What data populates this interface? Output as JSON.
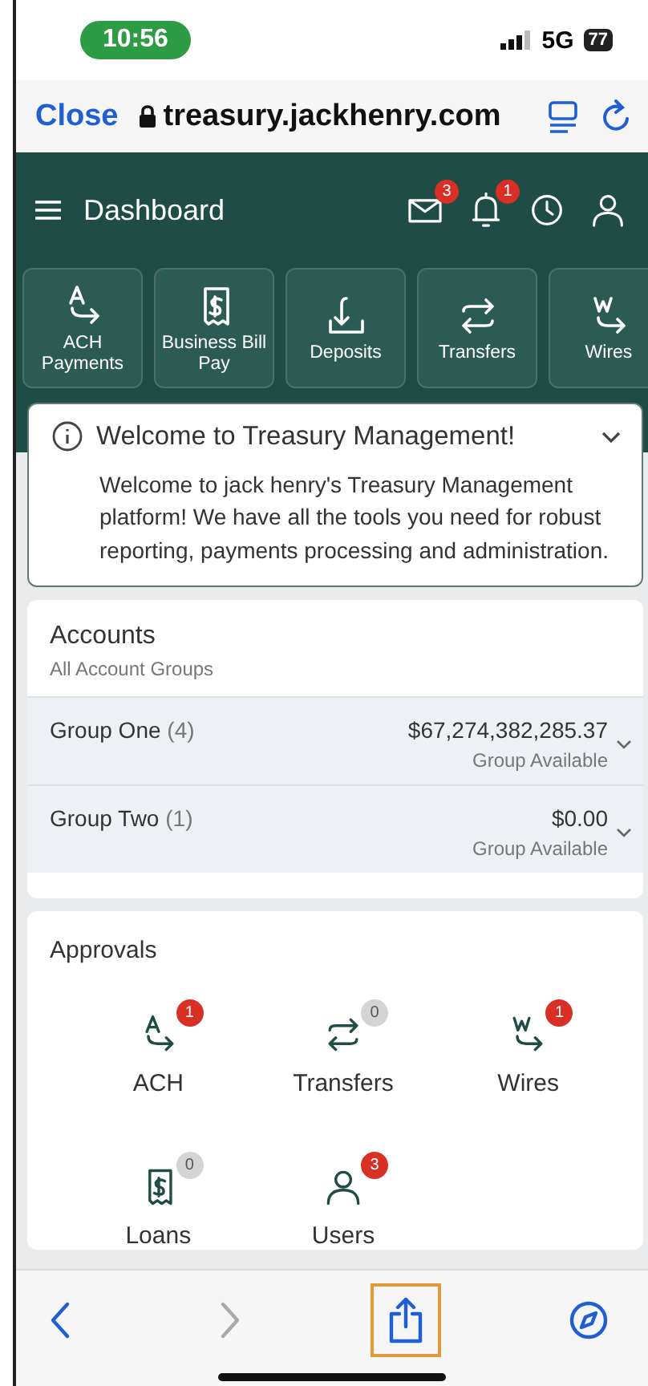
{
  "status_bar": {
    "time": "10:56",
    "network": "5G",
    "battery": "77"
  },
  "browser_bar": {
    "close": "Close",
    "url": "treasury.jackhenry.com"
  },
  "header": {
    "title": "Dashboard",
    "icons": [
      {
        "kind": "mail",
        "badge": "3"
      },
      {
        "kind": "bell",
        "badge": "1"
      },
      {
        "kind": "clock"
      },
      {
        "kind": "user"
      }
    ]
  },
  "quick_actions": [
    {
      "kind": "ach",
      "label": "ACH Payments"
    },
    {
      "kind": "bill",
      "label": "Business Bill Pay"
    },
    {
      "kind": "deposit",
      "label": "Deposits"
    },
    {
      "kind": "transfer",
      "label": "Transfers"
    },
    {
      "kind": "wire",
      "label": "Wires"
    }
  ],
  "welcome": {
    "title": "Welcome to Treasury Management!",
    "expanded": true,
    "body": "Welcome to jack henry's Treasury Management platform! We have all the tools you need for robust reporting, payments processing and administration."
  },
  "accounts": {
    "title": "Accounts",
    "subtitle": "All Account Groups",
    "groups": [
      {
        "name": "Group One",
        "count": "(4)",
        "amount": "$67,274,382,285.37",
        "caption": "Group Available"
      },
      {
        "name": "Group Two",
        "count": "(1)",
        "amount": "$0.00",
        "caption": "Group Available"
      }
    ]
  },
  "approvals": {
    "title": "Approvals",
    "items": [
      {
        "kind": "ach",
        "label": "ACH",
        "badge": "1",
        "color": "#d93025"
      },
      {
        "kind": "transfer",
        "label": "Transfers",
        "badge": "0",
        "color": "#d4d4d4"
      },
      {
        "kind": "wire",
        "label": "Wires",
        "badge": "1",
        "color": "#d93025"
      },
      {
        "kind": "bill",
        "label": "Loans",
        "badge": "0",
        "color": "#d4d4d4"
      },
      {
        "kind": "user",
        "label": "Users",
        "badge": "3",
        "color": "#d93025"
      }
    ]
  },
  "toolbar": [
    {
      "kind": "back",
      "disabled": false
    },
    {
      "kind": "forward",
      "disabled": true
    },
    {
      "kind": "share",
      "disabled": false,
      "selected": true
    },
    {
      "kind": "compass",
      "disabled": false
    }
  ]
}
